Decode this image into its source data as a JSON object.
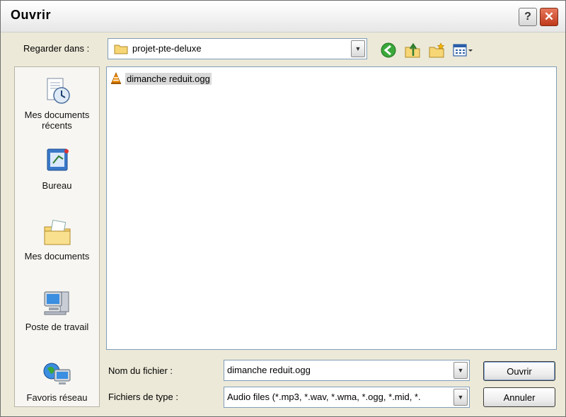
{
  "window": {
    "title": "Ouvrir",
    "help_glyph": "?",
    "close_glyph": "✕"
  },
  "lookin": {
    "label": "Regarder dans :",
    "value": "projet-pte-deluxe"
  },
  "places": [
    {
      "label": "Mes documents récents",
      "icon": "recent-documents-icon"
    },
    {
      "label": "Bureau",
      "icon": "desktop-icon"
    },
    {
      "label": "Mes documents",
      "icon": "my-documents-icon"
    },
    {
      "label": "Poste de travail",
      "icon": "my-computer-icon"
    },
    {
      "label": "Favoris réseau",
      "icon": "network-places-icon"
    }
  ],
  "files": [
    {
      "name": "dimanche reduit.ogg",
      "icon": "vlc-file-icon"
    }
  ],
  "filename": {
    "label": "Nom du fichier :",
    "value": "dimanche reduit.ogg"
  },
  "filetype": {
    "label": "Fichiers de type :",
    "value": "Audio files (*.mp3, *.wav, *.wma, *.ogg, *.mid, *."
  },
  "buttons": {
    "open": "Ouvrir",
    "cancel": "Annuler"
  }
}
